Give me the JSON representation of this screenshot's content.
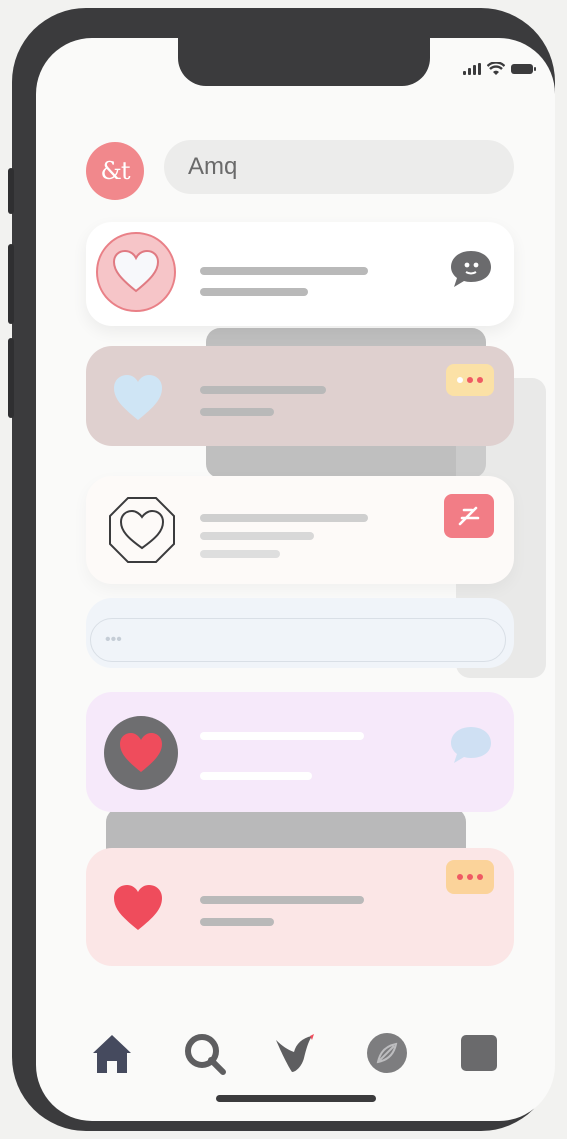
{
  "search": {
    "text": "Amq"
  },
  "header": {
    "avatar_text": "&t"
  },
  "cards": [
    {
      "name": "message-card-1",
      "icon": "heart-outline-icon",
      "action": "chat-bubble-icon"
    },
    {
      "name": "message-card-2",
      "icon": "heart-blue-icon",
      "action": "more-dots-icon"
    },
    {
      "name": "message-card-3",
      "icon": "heart-octagon-icon",
      "action": "edit-icon"
    },
    {
      "name": "message-card-4",
      "icon": "heart-red-icon",
      "action": "chat-bubble-icon"
    },
    {
      "name": "message-card-5",
      "icon": "heart-red-icon",
      "action": "more-dots-icon"
    }
  ],
  "composer": {
    "placeholder": "•••"
  },
  "tabs": [
    "home-icon",
    "search-icon",
    "bird-icon",
    "leaf-icon",
    "square-icon"
  ],
  "colors": {
    "accent": "#f1888c",
    "heart_red": "#ef4c5c",
    "phone_frame": "#3b3b3d"
  }
}
